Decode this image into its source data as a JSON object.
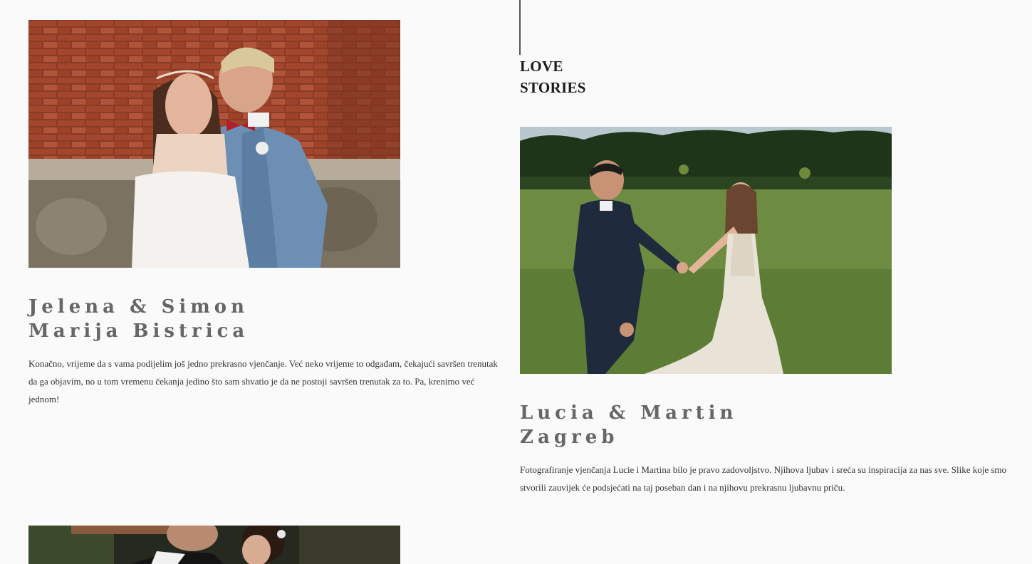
{
  "section": {
    "title_line1": "LOVE",
    "title_line2": "STORIES"
  },
  "stories": [
    {
      "names": "Jelena & Simon",
      "location": "Marija Bistrica",
      "text": "Konačno, vrijeme da s vama podijelim još jedno prekrasno vjenčanje. Već neko vrijeme to odgađam, čekajući savršen trenutak da ga objavim, no u tom vremenu čekanja jedino što sam shvatio je da ne postoji savršen trenutak za to. Pa, krenimo već jednom!"
    },
    {
      "names": "Lucia & Martin",
      "location": "Zagreb",
      "text": "Fotografiranje vjenčanja Lucie i Martina bilo je pravo zadovoljstvo. Njihova ljubav i sreća su inspiracija za nas sve. Slike koje smo stvorili zauvijek će podsjećati na taj poseban dan i na njihovu prekrasnu ljubavnu priču."
    }
  ],
  "colors": {
    "background": "#fafafa",
    "title_gray": "#666666",
    "text": "#333333",
    "accent_line": "#555555"
  }
}
